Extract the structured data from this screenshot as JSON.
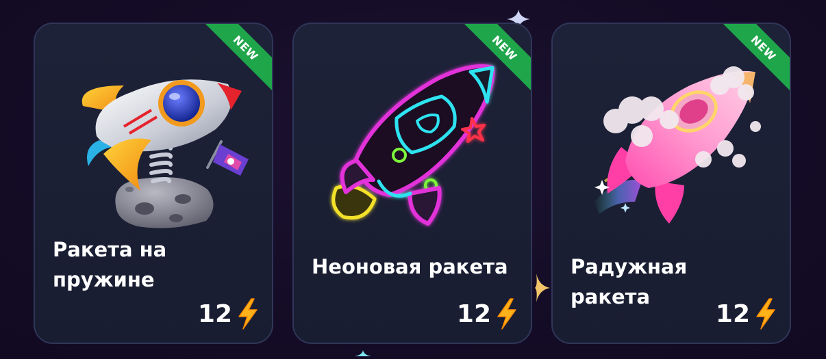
{
  "cards": [
    {
      "title": "Ракета на пружине",
      "badge": "NEW",
      "price": "12",
      "image_icon": "spring-rocket-icon",
      "currency_icon": "lightning-bolt-icon"
    },
    {
      "title": "Неоновая ракета",
      "badge": "NEW",
      "price": "12",
      "image_icon": "neon-rocket-icon",
      "currency_icon": "lightning-bolt-icon"
    },
    {
      "title": "Радужная ракета",
      "badge": "NEW",
      "price": "12",
      "image_icon": "rainbow-rocket-icon",
      "currency_icon": "lightning-bolt-icon"
    }
  ],
  "colors": {
    "background": "#150d27",
    "card_background": "#1d2238",
    "card_border": "#2f3658",
    "badge": "#1fa64a",
    "bolt": "#ffb21a",
    "text": "#ffffff"
  }
}
